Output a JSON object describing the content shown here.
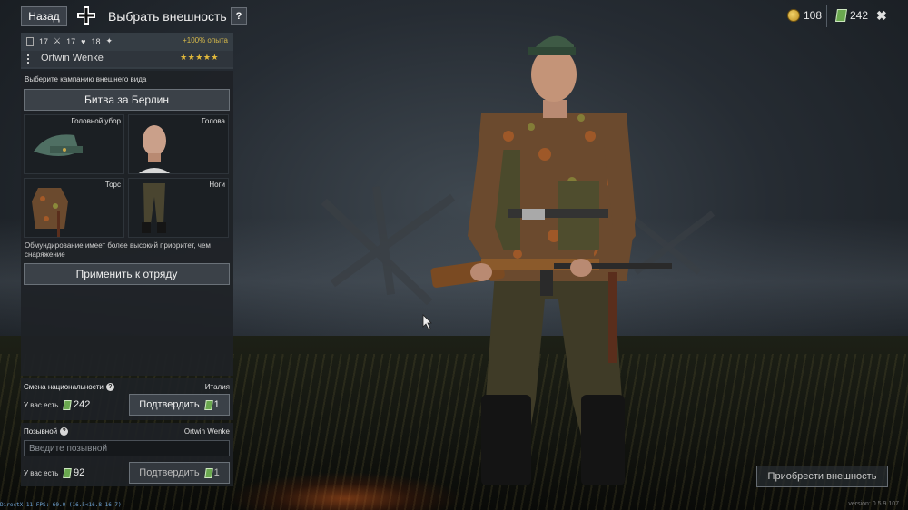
{
  "topbar": {
    "back_label": "Назад",
    "title": "Выбрать внешность",
    "help_label": "?",
    "gold": "108",
    "tickets": "242",
    "close_label": "✖"
  },
  "soldier": {
    "stat1": "17",
    "stat2": "17",
    "stat3": "18",
    "xp_bonus": "+100% опыта",
    "name": "Ortwin Wenke",
    "stars": "★★★★★"
  },
  "appearance": {
    "campaign_label": "Выберите кампанию внешнего вида",
    "campaign_value": "Битва за Берлин",
    "slots": [
      {
        "label": "Головной убор"
      },
      {
        "label": "Голова"
      },
      {
        "label": "Торс"
      },
      {
        "label": "Ноги"
      }
    ],
    "note": "Обмундирование имеет более высокий приоритет, чем снаряжение",
    "apply_label": "Применить к отряду"
  },
  "nationality": {
    "title": "Смена национальности",
    "country": "Италия",
    "have_label": "У вас есть",
    "have_value": "242",
    "confirm_label": "Подтвердить",
    "cost": "1"
  },
  "callsign": {
    "title": "Позывной",
    "current": "Ortwin Wenke",
    "placeholder": "Введите позывной",
    "have_label": "У вас есть",
    "have_value": "92",
    "confirm_label": "Подтвердить",
    "cost": "1"
  },
  "buy_label": "Приобрести внешность",
  "debug": "DirectX 11 FPS: 60.0 (16.5<16.8 16.7)",
  "version": "version: 0.5.9.107",
  "colors": {
    "accent_gold": "#e2b93b",
    "ticket_green": "#6aa84f",
    "panel_bg": "#1e2226"
  }
}
